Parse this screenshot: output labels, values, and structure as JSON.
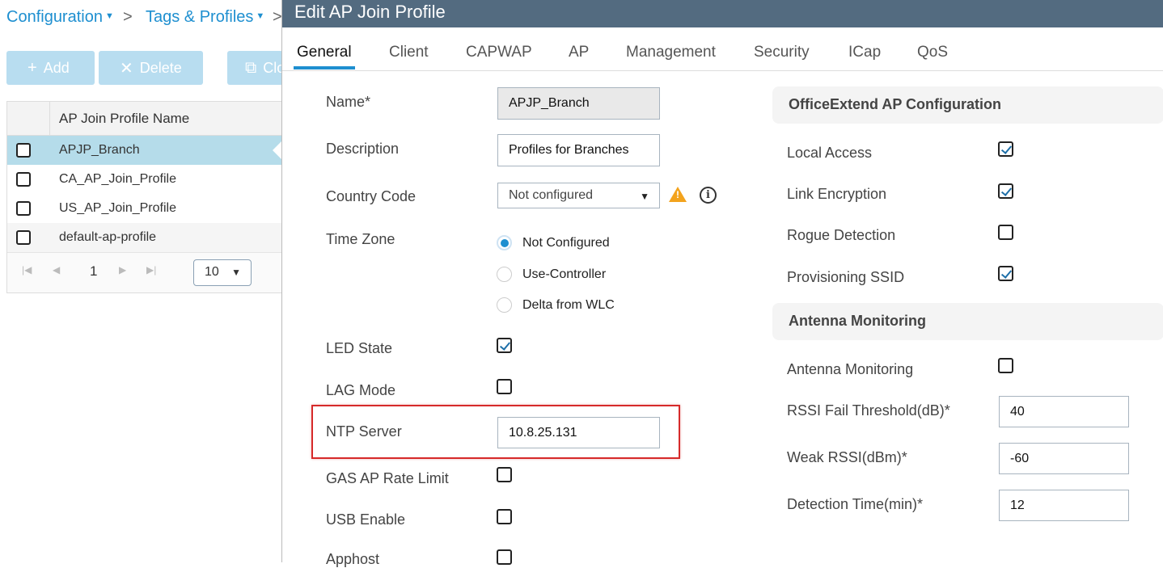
{
  "breadcrumb": {
    "configuration": "Configuration",
    "tags_profiles": "Tags & Profiles",
    "sep": ">"
  },
  "toolbar": {
    "add_label": "Add",
    "delete_label": "Delete",
    "clone_label": "Clone"
  },
  "profile_table": {
    "header": "AP Join Profile Name",
    "rows": [
      "APJP_Branch",
      "CA_AP_Join_Profile",
      "US_AP_Join_Profile",
      "default-ap-profile"
    ],
    "selected_index": 0,
    "pager": {
      "current_page": "1",
      "page_size": "10"
    }
  },
  "dialog": {
    "title": "Edit AP Join Profile",
    "tabs": [
      "General",
      "Client",
      "CAPWAP",
      "AP",
      "Management",
      "Security",
      "ICap",
      "QoS"
    ],
    "active_tab": "General",
    "general": {
      "name_label": "Name*",
      "name_value": "APJP_Branch",
      "description_label": "Description",
      "description_value": "Profiles for Branches",
      "country_label": "Country Code",
      "country_value": "Not configured",
      "timezone_label": "Time Zone",
      "timezone_options": [
        "Not Configured",
        "Use-Controller",
        "Delta from WLC"
      ],
      "timezone_selected": "Not Configured",
      "led_label": "LED State",
      "led_checked": true,
      "lag_label": "LAG Mode",
      "lag_checked": false,
      "ntp_label": "NTP Server",
      "ntp_value": "10.8.25.131",
      "gas_label": "GAS AP Rate Limit",
      "gas_checked": false,
      "usb_label": "USB Enable",
      "usb_checked": false,
      "apphost_label": "Apphost",
      "apphost_checked": false
    },
    "officeextend": {
      "section_title": "OfficeExtend AP Configuration",
      "local_access_label": "Local Access",
      "local_access_checked": true,
      "link_encryption_label": "Link Encryption",
      "link_encryption_checked": true,
      "rogue_detection_label": "Rogue Detection",
      "rogue_detection_checked": false,
      "provisioning_ssid_label": "Provisioning SSID",
      "provisioning_ssid_checked": true
    },
    "antenna": {
      "section_title": "Antenna Monitoring",
      "antenna_monitoring_label": "Antenna Monitoring",
      "antenna_monitoring_checked": false,
      "rssi_fail_label": "RSSI Fail Threshold(dB)*",
      "rssi_fail_value": "40",
      "weak_rssi_label": "Weak RSSI(dBm)*",
      "weak_rssi_value": "-60",
      "detection_time_label": "Detection Time(min)*",
      "detection_time_value": "12"
    }
  },
  "colors": {
    "accent": "#1e8fd0",
    "title_bar": "#536b80",
    "highlight_box": "#d62a2a",
    "warning": "#f3a31d"
  }
}
